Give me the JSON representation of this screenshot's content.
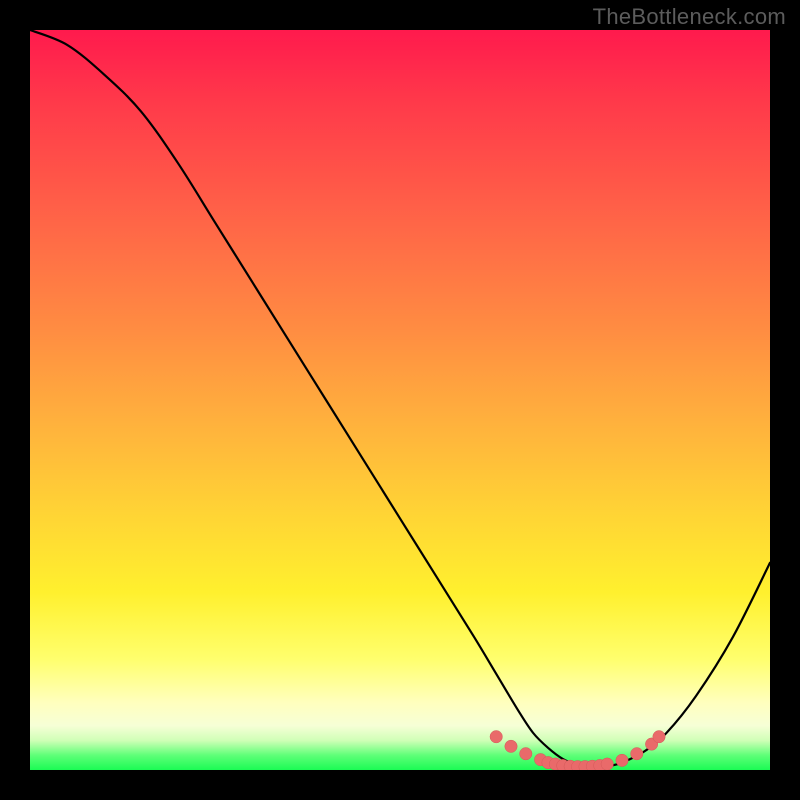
{
  "watermark": "TheBottleneck.com",
  "colors": {
    "background": "#000000",
    "curve": "#000000",
    "dots": "#e96a6a"
  },
  "chart_data": {
    "type": "line",
    "title": "",
    "xlabel": "",
    "ylabel": "",
    "xlim": [
      0,
      100
    ],
    "ylim": [
      0,
      100
    ],
    "grid": false,
    "legend": false,
    "series": [
      {
        "name": "bottleneck-curve",
        "x": [
          0,
          5,
          10,
          15,
          20,
          25,
          30,
          35,
          40,
          45,
          50,
          55,
          60,
          63,
          66,
          68,
          70,
          72,
          74,
          76,
          78,
          80,
          83,
          86,
          90,
          95,
          100
        ],
        "y": [
          100,
          98,
          94,
          89,
          82,
          74,
          66,
          58,
          50,
          42,
          34,
          26,
          18,
          13,
          8,
          5,
          3,
          1.5,
          0.7,
          0.4,
          0.5,
          1.0,
          2.5,
          5,
          10,
          18,
          28
        ]
      }
    ],
    "highlight_points": {
      "name": "minimum-band",
      "x": [
        63,
        65,
        67,
        69,
        70,
        71,
        72,
        73,
        74,
        75,
        76,
        77,
        78,
        80,
        82,
        84,
        85
      ],
      "y": [
        4.5,
        3.2,
        2.2,
        1.4,
        1.0,
        0.8,
        0.6,
        0.5,
        0.45,
        0.45,
        0.5,
        0.6,
        0.8,
        1.3,
        2.2,
        3.5,
        4.5
      ]
    }
  }
}
